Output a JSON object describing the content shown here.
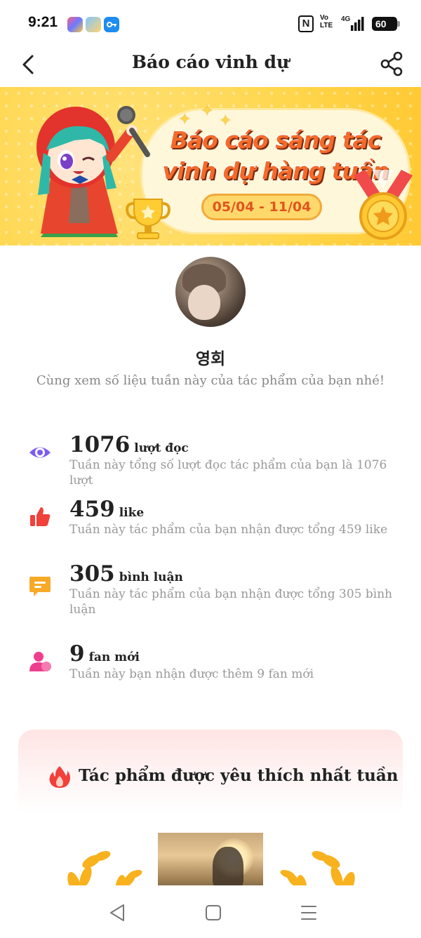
{
  "status_bar": {
    "time": "9:21",
    "nfc": "N",
    "volte_top": "Vo",
    "volte_bottom": "LTE",
    "network": "4G",
    "battery": "60"
  },
  "header": {
    "title": "Báo cáo vinh dự",
    "back_icon": "chevron-left-icon",
    "share_icon": "share-icon"
  },
  "banner": {
    "line1": "Báo cáo sáng tác",
    "line2": "vinh dự hàng tuần",
    "date_range": "05/04 - 11/04"
  },
  "profile": {
    "name": "영회",
    "subtitle": "Cùng xem số liệu tuần này của tác phẩm của bạn nhé!"
  },
  "stats": [
    {
      "icon": "eye-icon",
      "value": "1076",
      "unit": "lượt đọc",
      "description": "Tuần này tổng số lượt đọc tác phẩm của bạn là 1076 lượt",
      "color": "#7b5cf0"
    },
    {
      "icon": "thumbs-up-icon",
      "value": "459",
      "unit": "like",
      "description": "Tuần này tác phẩm của bạn nhận được tổng 459 like",
      "color": "#f2403a"
    },
    {
      "icon": "comment-icon",
      "value": "305",
      "unit": "bình luận",
      "description": "Tuần này tác phẩm của bạn nhận được tổng 305 bình luận",
      "color": "#f7a928"
    },
    {
      "icon": "person-icon",
      "value": "9",
      "unit": "fan mới",
      "description": "Tuần này bạn nhận được thêm 9 fan mới",
      "color": "#ee3f8f"
    }
  ],
  "favorite": {
    "title": "Tác phẩm được yêu thích nhất tuần",
    "icon": "fire-icon"
  },
  "nav": {
    "back_icon": "triangle-back-icon",
    "home_icon": "square-home-icon",
    "menu_icon": "menu-lines-icon"
  }
}
